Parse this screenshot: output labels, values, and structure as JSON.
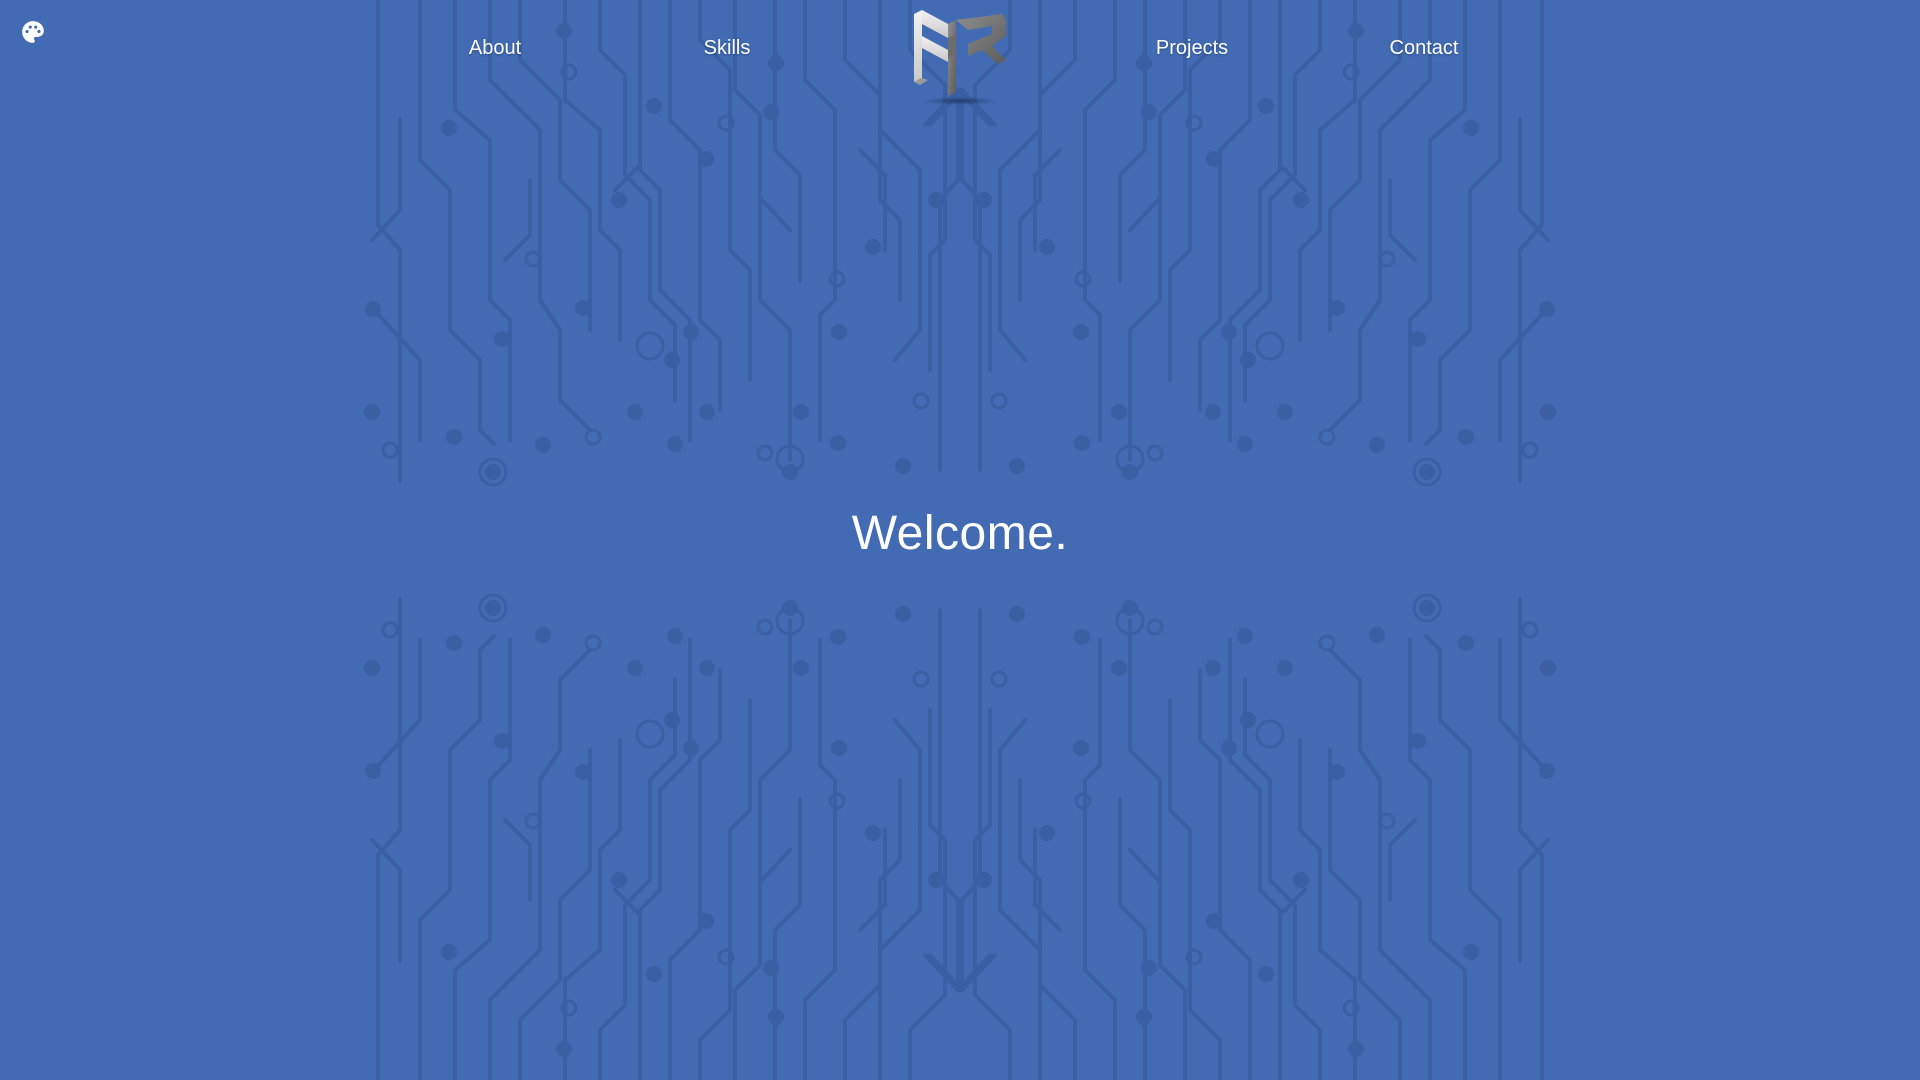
{
  "nav": {
    "about": "About",
    "skills": "Skills",
    "projects": "Projects",
    "contact": "Contact"
  },
  "hero": {
    "title": "Welcome."
  },
  "icons": {
    "theme_toggle": "palette-icon",
    "logo": "ar-logo"
  },
  "colors": {
    "background": "#426bb4",
    "circuit": "#3a5fa3",
    "text": "#ffffff"
  }
}
